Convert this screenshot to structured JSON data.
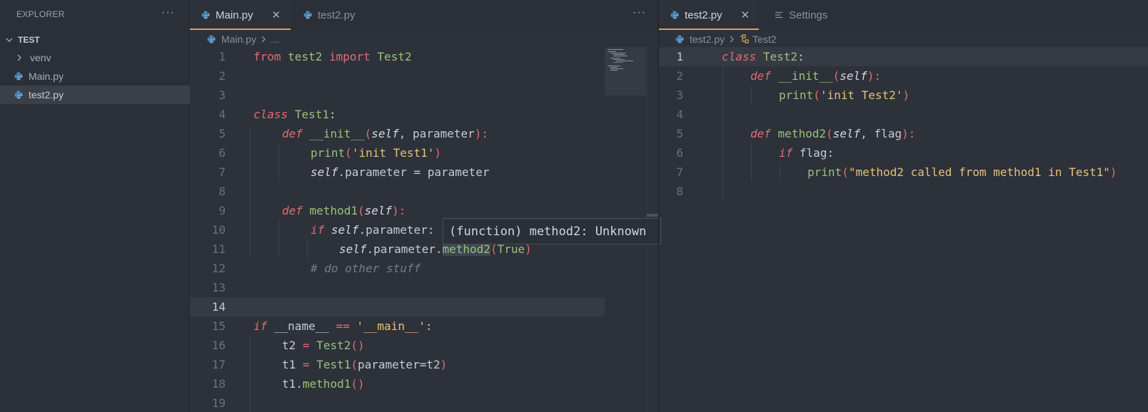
{
  "sidebar": {
    "title": "EXPLORER",
    "more": "···",
    "folder": "TEST",
    "items": [
      {
        "label": "venv",
        "type": "folder"
      },
      {
        "label": "Main.py",
        "type": "py"
      },
      {
        "label": "test2.py",
        "type": "py",
        "selected": true
      }
    ]
  },
  "left_pane": {
    "tabs": [
      {
        "label": "Main.py",
        "active": true,
        "close": "✕"
      },
      {
        "label": "test2.py",
        "active": false
      }
    ],
    "more": "···",
    "breadcrumb": {
      "file": "Main.py",
      "tail": "..."
    },
    "current_line": 14,
    "lines": [
      {
        "n": "1"
      },
      {
        "n": "2"
      },
      {
        "n": "3"
      },
      {
        "n": "4"
      },
      {
        "n": "5"
      },
      {
        "n": "6"
      },
      {
        "n": "7"
      },
      {
        "n": "8"
      },
      {
        "n": "9"
      },
      {
        "n": "10"
      },
      {
        "n": "11"
      },
      {
        "n": "12"
      },
      {
        "n": "13"
      },
      {
        "n": "14"
      },
      {
        "n": "15"
      },
      {
        "n": "16"
      },
      {
        "n": "17"
      },
      {
        "n": "18"
      },
      {
        "n": "19"
      }
    ],
    "tooltip": "(function) method2: Unknown"
  },
  "right_pane": {
    "tabs": [
      {
        "label": "test2.py",
        "active": true,
        "close": "✕"
      },
      {
        "label": "Settings",
        "active": false
      }
    ],
    "breadcrumb": {
      "file": "test2.py",
      "symbol": "Test2"
    },
    "current_line": 1,
    "lines": [
      {
        "n": "1"
      },
      {
        "n": "2"
      },
      {
        "n": "3"
      },
      {
        "n": "4"
      },
      {
        "n": "5"
      },
      {
        "n": "6"
      },
      {
        "n": "7"
      },
      {
        "n": "8"
      }
    ]
  },
  "code": {
    "main": {
      "l1": {
        "a": "from",
        "b": "test2",
        "c": "import",
        "d": "Test2"
      },
      "l4": {
        "a": "class",
        "b": "Test1",
        "c": ":"
      },
      "l5": {
        "a": "def",
        "b": "__init__",
        "c": "(",
        "d": "self",
        "e": ", parameter",
        "f": "):"
      },
      "l6": {
        "a": "print",
        "b": "(",
        "c": "'init Test1'",
        "d": ")"
      },
      "l7": {
        "a": "self",
        "b": ".parameter = parameter"
      },
      "l9": {
        "a": "def",
        "b": "method1",
        "c": "(",
        "d": "self",
        "e": "):"
      },
      "l10": {
        "a": "if",
        "b": "self",
        "c": ".parameter:"
      },
      "l11": {
        "a": "self",
        "b": ".parameter.",
        "c": "method2",
        "d": "(",
        "e": "True",
        "f": ")"
      },
      "l12": {
        "a": "# do other stuff"
      },
      "l15": {
        "a": "if",
        "b": "__name__",
        "c": "==",
        "d": "'__main__'",
        "e": ":"
      },
      "l16": {
        "a": "t2",
        "b": "=",
        "c": "Test2",
        "d": "()"
      },
      "l17": {
        "a": "t1",
        "b": "=",
        "c": "Test1",
        "d": "(",
        "e": "parameter=t2",
        "f": ")"
      },
      "l18": {
        "a": "t1.",
        "b": "method1",
        "c": "()"
      }
    },
    "test2": {
      "l1": {
        "a": "class",
        "b": "Test2",
        "c": ":"
      },
      "l2": {
        "a": "def",
        "b": "__init__",
        "c": "(",
        "d": "self",
        "e": "):"
      },
      "l3": {
        "a": "print",
        "b": "(",
        "c": "'init Test2'",
        "d": ")"
      },
      "l5": {
        "a": "def",
        "b": "method2",
        "c": "(",
        "d": "self",
        "e": ", flag",
        "f": "):"
      },
      "l6": {
        "a": "if",
        "b": "flag:"
      },
      "l7": {
        "a": "print",
        "b": "(",
        "c": "\"method2 called from method1 in Test1\"",
        "d": ")"
      }
    }
  },
  "colors": {
    "background": "#2d3139",
    "keyword": "#e06c75",
    "class_name": "#98c379",
    "string": "#e5c07b",
    "tab_accent": "#d9a557",
    "python_icon": "#4b8bbe"
  }
}
